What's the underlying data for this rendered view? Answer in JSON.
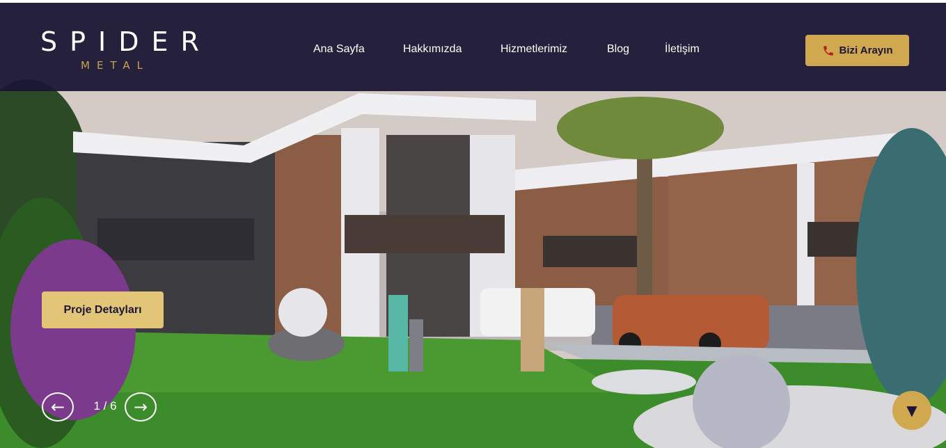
{
  "brand": {
    "name": "SPIDER",
    "tagline": "METAL"
  },
  "nav": {
    "items": [
      "Ana Sayfa",
      "Hakkımızda",
      "Hizmetlerimiz",
      "Blog",
      "İletişim"
    ]
  },
  "call_button": {
    "label": "Bizi Arayın",
    "icon": "phone-icon"
  },
  "hero": {
    "image": "modern-villa-render",
    "project_button": "Proje Detayları",
    "slide_counter": "1 / 6",
    "prev_label": "←",
    "next_label": "→",
    "scroll_label": "▼"
  },
  "colors": {
    "navbar": "#1a1634",
    "accent_gold": "#cfa850",
    "button_light_gold": "#e3c577",
    "text_white": "#ffffff"
  }
}
